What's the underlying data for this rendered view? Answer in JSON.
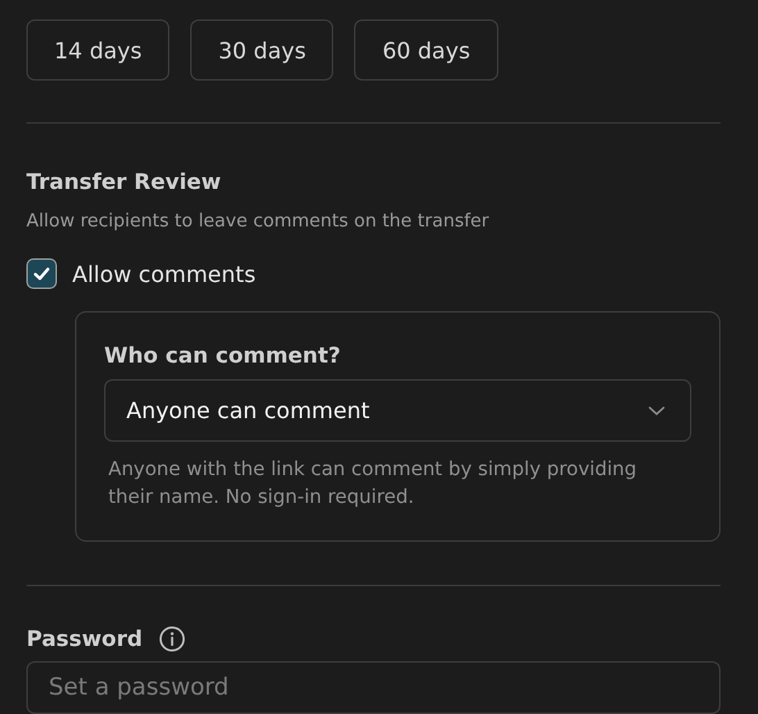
{
  "durations": [
    {
      "label": "14 days",
      "selected": false
    },
    {
      "label": "30 days",
      "selected": false
    },
    {
      "label": "60 days",
      "selected": false
    }
  ],
  "transfer_review": {
    "title": "Transfer Review",
    "description": "Allow recipients to leave comments on the transfer",
    "checkbox": {
      "label": "Allow comments",
      "checked": true
    },
    "options": {
      "label": "Who can comment?",
      "select_value": "Anyone can comment",
      "help": "Anyone with the link can comment by simply providing their name. No sign-in required."
    }
  },
  "password": {
    "label": "Password",
    "placeholder": "Set a password"
  }
}
